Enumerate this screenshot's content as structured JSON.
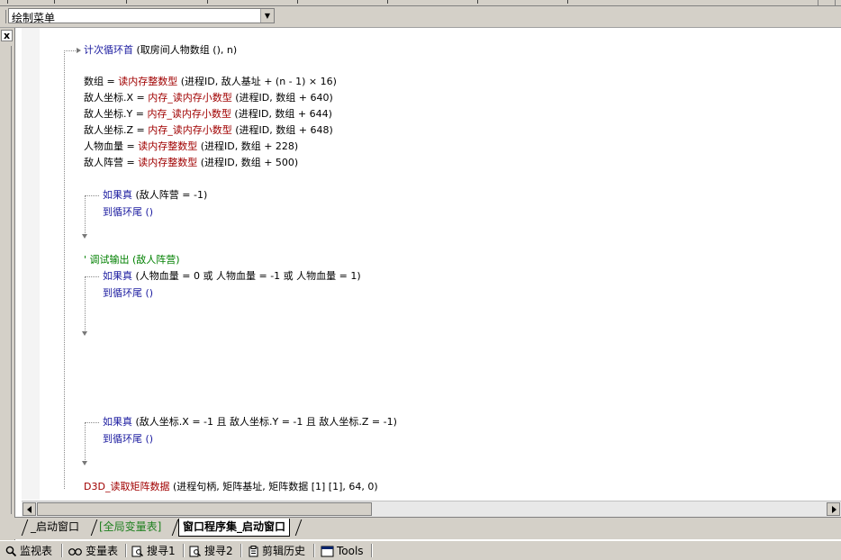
{
  "toolbar": {
    "combo_value": "绘制菜单"
  },
  "panel": {
    "close_label": "x"
  },
  "code": {
    "loop_keyword": "计次循环首",
    "loop_args": " (取房间人物数组 (), n)",
    "line1_var": "数组 = ",
    "line1_fn": "读内存整数型",
    "line1_args": " (进程ID, 敌人基址 + (n - 1) × 16)",
    "line2_var": "敌人坐标.X = ",
    "line2_fn": "内存_读内存小数型",
    "line2_args": " (进程ID, 数组 + 640)",
    "line3_var": "敌人坐标.Y = ",
    "line3_fn": "内存_读内存小数型",
    "line3_args": " (进程ID, 数组 + 644)",
    "line4_var": "敌人坐标.Z = ",
    "line4_fn": "内存_读内存小数型",
    "line4_args": " (进程ID, 数组 + 648)",
    "line5_var": "人物血量 = ",
    "line5_fn": "读内存整数型",
    "line5_args": " (进程ID, 数组 + 228)",
    "line6_var": "敌人阵营 = ",
    "line6_fn": "读内存整数型",
    "line6_args": " (进程ID, 数组 + 500)",
    "if1_kw": "如果真",
    "if1_args": " (敌人阵营 = -1)",
    "if1_body": "到循环尾 ()",
    "comment": "' 调试输出 (敌人阵营)",
    "if2_kw": "如果真",
    "if2_args": " (人物血量 = 0 或 人物血量 = -1 或 人物血量 = 1)",
    "if2_body": "到循环尾 ()",
    "if3_kw": "如果真",
    "if3_args": " (敌人坐标.X = -1 且 敌人坐标.Y = -1 且 敌人坐标.Z = -1)",
    "if3_body": "到循环尾 ()",
    "last_fn": "D3D_读取矩阵数据",
    "last_args": " (进程句柄, 矩阵基址, 矩阵数据 [1] [1], 64, 0)"
  },
  "tabs": [
    {
      "label": "_启动窗口"
    },
    {
      "label": "[全局变量表]"
    },
    {
      "label": "窗口程序集_启动窗口"
    }
  ],
  "bottom_bar": {
    "items": [
      {
        "label": "监视表",
        "icon": "magnifier-icon"
      },
      {
        "label": "变量表",
        "icon": "variables-icon"
      },
      {
        "label": "搜寻1",
        "icon": "find-icon"
      },
      {
        "label": "搜寻2",
        "icon": "find-icon"
      },
      {
        "label": "剪辑历史",
        "icon": "clipboard-icon"
      },
      {
        "label": "Tools",
        "icon": "window-icon"
      }
    ]
  }
}
